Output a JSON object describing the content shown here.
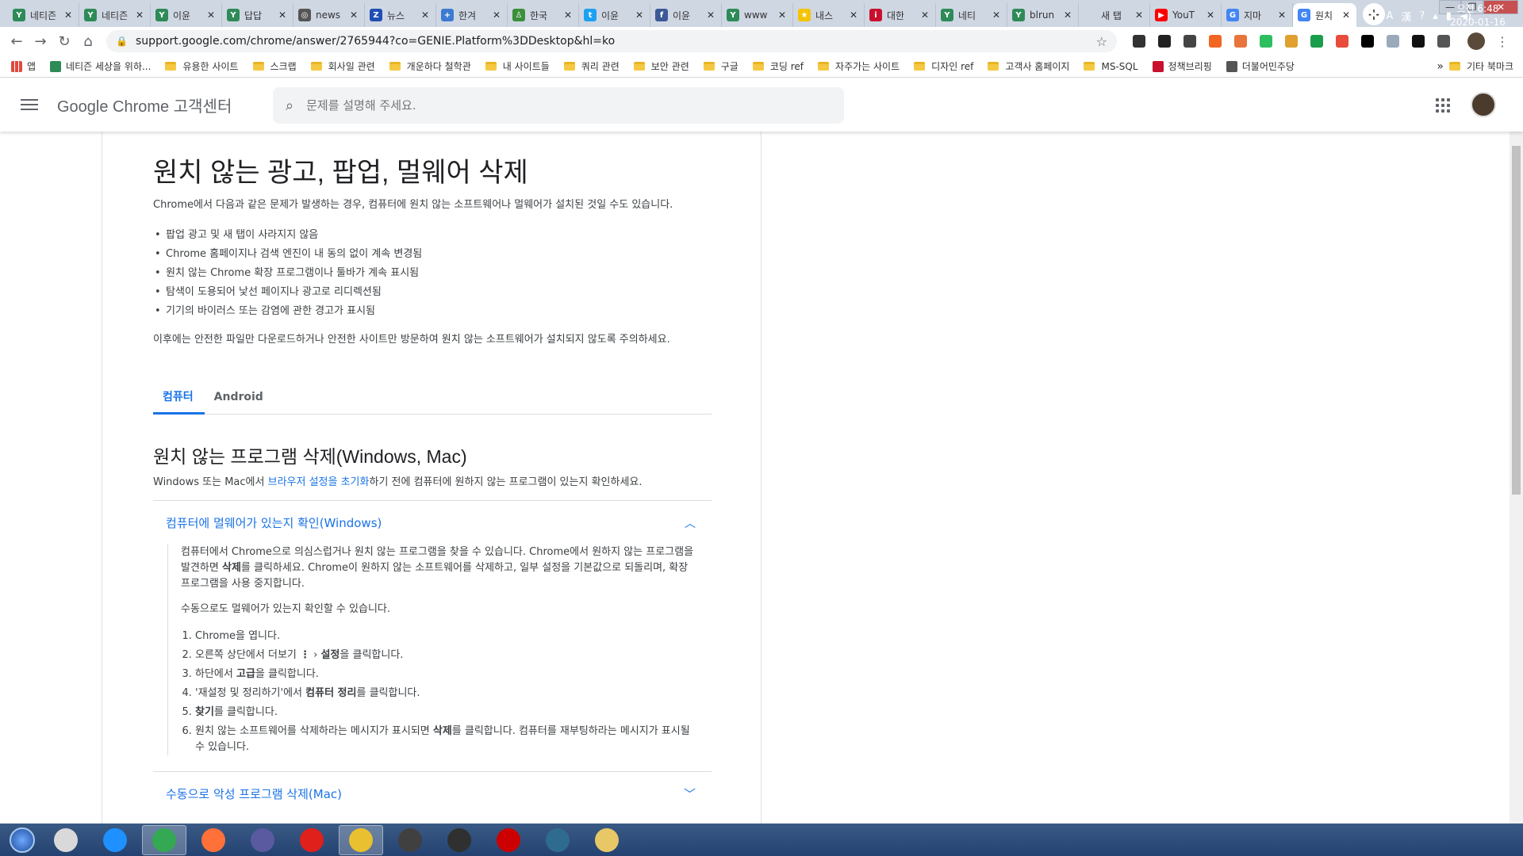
{
  "tabs": [
    {
      "title": "네티즌",
      "color": "#2e8b57",
      "glyph": "Y"
    },
    {
      "title": "네티즌",
      "color": "#2e8b57",
      "glyph": "Y"
    },
    {
      "title": "이윤",
      "color": "#2e8b57",
      "glyph": "Y"
    },
    {
      "title": "답답",
      "color": "#2e8b57",
      "glyph": "Y"
    },
    {
      "title": "news",
      "color": "#555555",
      "glyph": "◎"
    },
    {
      "title": "뉴스",
      "color": "#1f4fb5",
      "glyph": "Z"
    },
    {
      "title": "한겨",
      "color": "#3d7bd1",
      "glyph": "+"
    },
    {
      "title": "한국",
      "color": "#3a8f3a",
      "glyph": "♙"
    },
    {
      "title": "이윤",
      "color": "#1da1f2",
      "glyph": "t"
    },
    {
      "title": "이윤",
      "color": "#3b5998",
      "glyph": "f"
    },
    {
      "title": "www",
      "color": "#2e8b57",
      "glyph": "Y"
    },
    {
      "title": "내스",
      "color": "#f5c400",
      "glyph": "★"
    },
    {
      "title": "대한",
      "color": "#c8102e",
      "glyph": "i"
    },
    {
      "title": "네티",
      "color": "#2e8b57",
      "glyph": "Y"
    },
    {
      "title": "blrun",
      "color": "#2e8b57",
      "glyph": "Y"
    },
    {
      "title": "새 탭",
      "color": "#cfd7e3",
      "glyph": ""
    },
    {
      "title": "YouT",
      "color": "#ff0000",
      "glyph": "▶"
    },
    {
      "title": "지마",
      "color": "#4285f4",
      "glyph": "G"
    },
    {
      "title": "원치",
      "color": "#4285f4",
      "glyph": "G",
      "active": true
    }
  ],
  "window": {
    "minimize": "—",
    "maximize": "❐",
    "close": "✕"
  },
  "address": {
    "url": "support.google.com/chrome/answer/2765944?co=GENIE.Platform%3DDesktop&hl=ko"
  },
  "bookmarks": [
    {
      "label": "앱",
      "type": "apps"
    },
    {
      "label": "네티즌 세상을 위하...",
      "type": "icon",
      "color": "#2e8b57"
    },
    {
      "label": "유용한 사이트",
      "type": "folder"
    },
    {
      "label": "스크랩",
      "type": "folder"
    },
    {
      "label": "회사일 관련",
      "type": "folder"
    },
    {
      "label": "개운하다 철학관",
      "type": "folder"
    },
    {
      "label": "내 사이트들",
      "type": "folder"
    },
    {
      "label": "쿼리 관련",
      "type": "folder"
    },
    {
      "label": "보안 관련",
      "type": "folder"
    },
    {
      "label": "구글",
      "type": "folder"
    },
    {
      "label": "코딩 ref",
      "type": "folder"
    },
    {
      "label": "자주가는 사이트",
      "type": "folder"
    },
    {
      "label": "디자인 ref",
      "type": "folder"
    },
    {
      "label": "고객사 홈페이지",
      "type": "folder"
    },
    {
      "label": "MS-SQL",
      "type": "folder"
    },
    {
      "label": "정책브리핑",
      "type": "icon",
      "color": "#c8102e"
    },
    {
      "label": "더불어민주당",
      "type": "icon",
      "color": "#555555"
    }
  ],
  "bookmarks_more": "»",
  "bookmarks_other": "기타 북마크",
  "help": {
    "brand": "Google Chrome 고객센터",
    "search_placeholder": "문제를 설명해 주세요."
  },
  "article": {
    "title": "원치 않는 광고, 팝업, 멀웨어 삭제",
    "intro": "Chrome에서 다음과 같은 문제가 발생하는 경우, 컴퓨터에 원치 않는 소프트웨어나 멀웨어가 설치된 것일 수도 있습니다.",
    "bullets": [
      "팝업 광고 및 새 탭이 사라지지 않음",
      "Chrome 홈페이지나 검색 엔진이 내 동의 없이 계속 변경됨",
      "원치 않는 Chrome 확장 프로그램이나 툴바가 계속 표시됨",
      "탐색이 도용되어 낯선 페이지나 광고로 리디렉션됨",
      "기기의 바이러스 또는 감염에 관한 경고가 표시됨"
    ],
    "outro": "이후에는 안전한 파일만 다운로드하거나 안전한 사이트만 방문하여 원치 않는 소프트웨어가 설치되지 않도록 주의하세요.",
    "tabs": [
      "컴퓨터",
      "Android"
    ],
    "section_title": "원치 않는 프로그램 삭제(Windows, Mac)",
    "section_text_pre": "Windows 또는 Mac에서 ",
    "section_link": "브라우저 설정을 초기화",
    "section_text_post": "하기 전에 컴퓨터에 원하지 않는 프로그램이 있는지 확인하세요.",
    "acc1_title": "컴퓨터에 멀웨어가 있는지 확인(Windows)",
    "acc1_p1_a": "컴퓨터에서 Chrome으로 의심스럽거나 원치 않는 프로그램을 찾을 수 있습니다. Chrome에서 원하지 않는 프로그램을 발견하면 ",
    "acc1_p1_b": "삭제",
    "acc1_p1_c": "를 클릭하세요. Chrome이 원하지 않는 소프트웨어를 삭제하고, 일부 설정을 기본값으로 되돌리며, 확장 프로그램을 사용 중지합니다.",
    "acc1_p2": "수동으로도 멀웨어가 있는지 확인할 수 있습니다.",
    "steps": {
      "s1": "Chrome을 엽니다.",
      "s2_a": "오른쪽 상단에서 더보기 ",
      "s2_icon": "⋮",
      "s2_sep": " › ",
      "s2_b": "설정",
      "s2_c": "을 클릭합니다.",
      "s3_a": "하단에서 ",
      "s3_b": "고급",
      "s3_c": "을 클릭합니다.",
      "s4_a": "'재설정 및 정리하기'에서 ",
      "s4_b": "컴퓨터 정리",
      "s4_c": "를 클릭합니다.",
      "s5_b": "찾기",
      "s5_c": "를 클릭합니다.",
      "s6_a": "원치 않는 소프트웨어를 삭제하라는 메시지가 표시되면 ",
      "s6_b": "삭제",
      "s6_c": "를 클릭합니다. 컴퓨터를 재부팅하라는 메시지가 표시될 수 있습니다."
    },
    "acc2_title": "수동으로 악성 프로그램 삭제(Mac)"
  },
  "taskbar": {
    "apps": [
      {
        "name": "vivaldi",
        "color": "#d9d9d9"
      },
      {
        "name": "ie",
        "color": "#1e90ff"
      },
      {
        "name": "chrome",
        "color": "#34a853",
        "active": true
      },
      {
        "name": "firefox",
        "color": "#ff7139"
      },
      {
        "name": "app",
        "color": "#5a5aa0"
      },
      {
        "name": "opera",
        "color": "#e0201b"
      },
      {
        "name": "tool",
        "color": "#e8c030",
        "active": true
      },
      {
        "name": "app",
        "color": "#404040"
      },
      {
        "name": "app",
        "color": "#303030"
      },
      {
        "name": "record",
        "color": "#cc0000"
      },
      {
        "name": "app",
        "color": "#2f6b8f"
      },
      {
        "name": "explorer",
        "color": "#e8c766"
      }
    ],
    "tray_lang": "A",
    "tray_ime": "漢",
    "time": "오전 6:48",
    "date": "2020-01-16"
  }
}
